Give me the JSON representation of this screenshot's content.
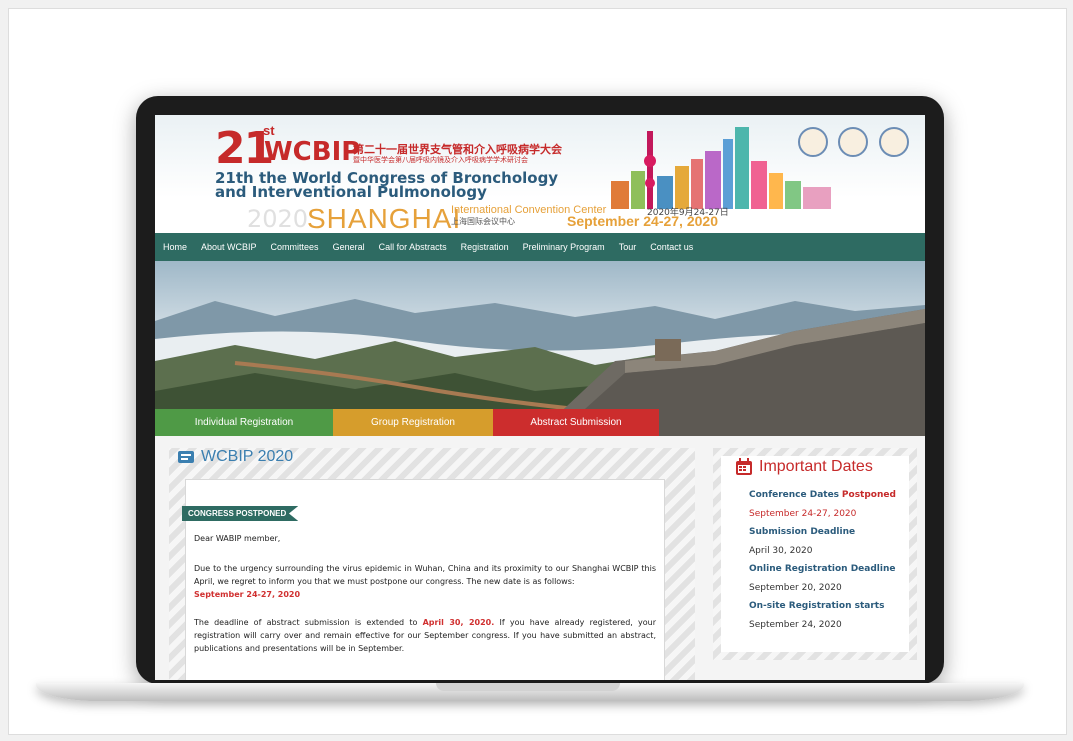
{
  "header": {
    "edition_number": "21",
    "edition_suffix": "st",
    "acronym": "WCBIP",
    "chinese_title": "第二十一届世界支气管和介入呼吸病学大会",
    "chinese_subtitle": "暨中华医学会第八届呼吸内镜及介入呼吸病学学术研讨会",
    "english_title": "21th the World Congress of Bronchology and Interventional Pulmonology",
    "year_watermark": "2020",
    "city": "SHANGHAI",
    "venue": "International Convention Center",
    "venue_cn": "上海国际会议中心",
    "date_cn": "2020年9月24-27日",
    "date_en": "September 24-27, 2020"
  },
  "nav": {
    "items": [
      "Home",
      "About WCBIP",
      "Committees",
      "General",
      "Call for Abstracts",
      "Registration",
      "Preliminary Program",
      "Tour",
      "Contact us"
    ]
  },
  "hero": {
    "buttons": [
      {
        "label": "Individual Registration",
        "color": "#4f9a46"
      },
      {
        "label": "Group Registration",
        "color": "#d69d2c"
      },
      {
        "label": "Abstract Submission",
        "color": "#cc2d2d"
      }
    ]
  },
  "main": {
    "title": "WCBIP 2020",
    "tag": "CONGRESS POSTPONED",
    "greeting": "Dear WABIP member,",
    "para1": "Due to the urgency surrounding the virus epidemic in Wuhan, China and its proximity to our Shanghai WCBIP this April, we regret to inform you that we must postpone our congress. The new date is as follows:",
    "para1_date": "September 24-27, 2020",
    "para2_a": "The deadline of abstract submission is extended to",
    "para2_date": "April 30, 2020.",
    "para2_b": "If you have already registered, your registration will carry over and remain effective for our September congress.  If you have submitted an abstract, publications and presentations will be in September."
  },
  "sidebar": {
    "title": "Important Dates",
    "conf_label": "Conference Dates",
    "conf_status": "Postponed",
    "conf_value": "September 24-27, 2020",
    "items": [
      {
        "label": "Submission Deadline",
        "value": "April 30, 2020"
      },
      {
        "label": "Online Registration Deadline",
        "value": "September 20, 2020"
      },
      {
        "label": "On-site Registration starts",
        "value": "September 24, 2020"
      }
    ]
  },
  "colors": {
    "nav_bg": "#2e6b62",
    "accent_red": "#c62a2a",
    "title_blue": "#3b7fb0"
  }
}
